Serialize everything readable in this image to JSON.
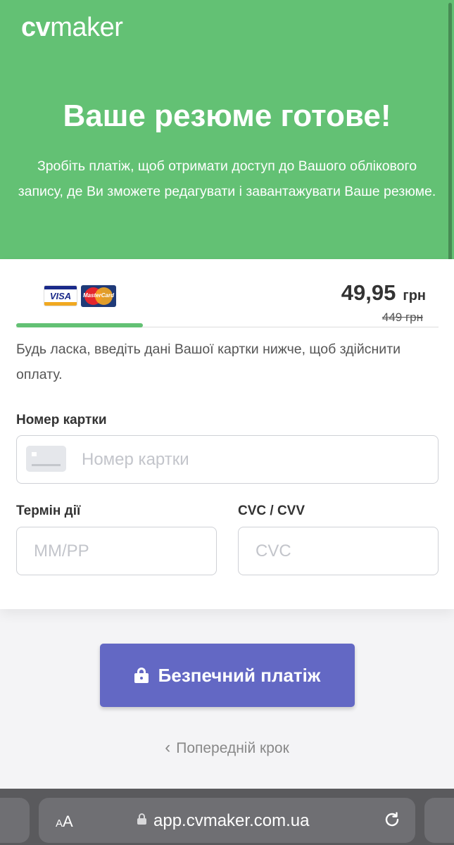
{
  "brand": {
    "logo_cv": "cv",
    "logo_maker": "maker"
  },
  "hero": {
    "title": "Ваше резюме готове!",
    "subtitle": "Зробіть платіж, щоб отримати доступ до Вашого облікового запису, де Ви зможете редагувати і завантажувати Ваше резюме."
  },
  "payment": {
    "card_brands": {
      "visa": "VISA",
      "mastercard": "MasterCard"
    },
    "price": "49,95",
    "currency": "грн",
    "old_price": "449 грн",
    "progress_fraction": 0.3,
    "instruction": "Будь ласка, введіть дані Вашої картки нижче, щоб здійснити оплату.",
    "card_number": {
      "label": "Номер картки",
      "placeholder": "Номер картки",
      "value": ""
    },
    "expiry": {
      "label": "Термін дії",
      "placeholder": "ММ/РР",
      "value": ""
    },
    "cvc": {
      "label": "CVC / CVV",
      "placeholder": "CVC",
      "value": ""
    }
  },
  "actions": {
    "pay_button": "Безпечний платіж",
    "back_link": "Попередній крок"
  },
  "browser": {
    "text_size_label_small": "A",
    "text_size_label_big": "A",
    "url": "app.cvmaker.com.ua"
  },
  "colors": {
    "brand_green": "#63c174",
    "pay_button": "#6368c4",
    "text_dark": "#333333"
  }
}
